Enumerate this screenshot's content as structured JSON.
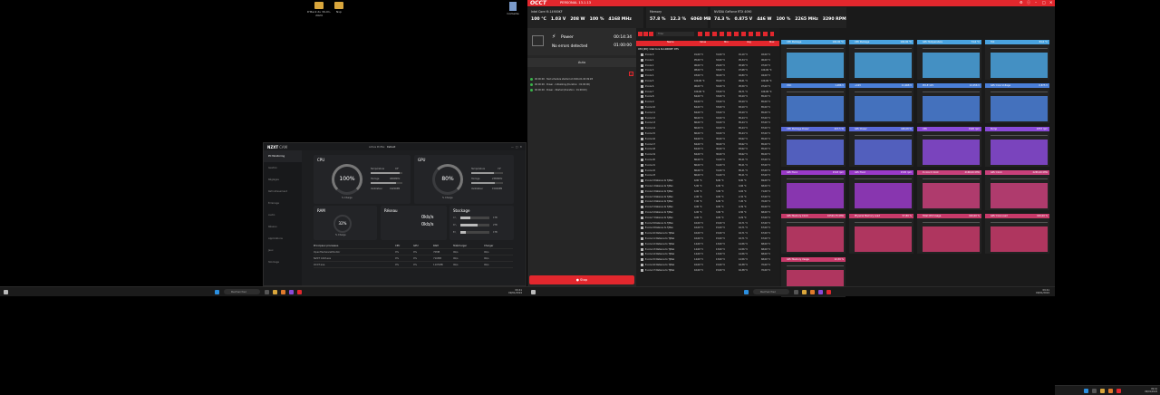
{
  "desktop": {
    "icons": [
      {
        "label": "D'Back du 30-01-2024",
        "kind": "folder"
      },
      {
        "label": "Nvp",
        "kind": "folder"
      },
      {
        "label": "Corbeille",
        "kind": "bin"
      }
    ]
  },
  "taskbar_left": {
    "search": "Rechercher",
    "time": "09:41",
    "date": "09/01/2024"
  },
  "taskbar_right": {
    "search": "Rechercher",
    "time": "09:41",
    "date": "09/01/2024"
  },
  "taskbar_far": {
    "time": "09:41",
    "date": "09/01/2024"
  },
  "nzxt": {
    "brand": "NZXT",
    "app": "CAM",
    "profile_label": "Active Profile:",
    "profile_value": "Default",
    "sidebar": [
      "PC Monitoring",
      "Gestion",
      "Réglages",
      "Refroidissement",
      "Éclairage",
      "Audio",
      "Réseau",
      "Applications",
      "Jeux",
      "Stockage"
    ],
    "cpu": {
      "title": "CPU",
      "load": "100%",
      "temp_label": "Température",
      "temp": "93°",
      "clock_label": "Horloge",
      "clock": "4800MHz",
      "fan_label": "Ventilateur",
      "fan": "1920RPM",
      "sub": "% Charge"
    },
    "gpu": {
      "title": "GPU",
      "load": "80%",
      "temp_label": "Température",
      "temp": "74°",
      "clock_label": "Horloge",
      "clock": "2385MHz",
      "fan_label": "Ventilateur",
      "fan": "1500RPM",
      "sub": "% Charge"
    },
    "ram": {
      "title": "RAM",
      "load": "32%",
      "sub": "% Charge"
    },
    "network": {
      "title": "Réseau",
      "down": "0kb/s",
      "up": "0kb/s"
    },
    "storage": {
      "title": "Stockage",
      "drives": [
        {
          "letter": "C:\\",
          "size": "1TB",
          "fill": 0.35
        },
        {
          "letter": "D:\\",
          "size": "2TB",
          "fill": 0.6
        },
        {
          "letter": "E:\\",
          "size": "1TB",
          "fill": 0.2
        }
      ]
    },
    "processes": {
      "headers": [
        "Principaux processus",
        "CPU",
        "GPU",
        "RAM",
        "Télécharger",
        "Charger"
      ],
      "rows": [
        [
          "OpenHardwareMonitor",
          "0%",
          "0%",
          "70MB",
          "0b/s",
          "0b/s"
        ],
        [
          "NZXT CAM.exe",
          "0%",
          "0%",
          "716MB",
          "0b/s",
          "0b/s"
        ],
        [
          "OCCT.exe",
          "0%",
          "0%",
          "1105MB",
          "0b/s",
          "0b/s"
        ]
      ]
    }
  },
  "occt": {
    "logo": "OCCT",
    "edition": "PERSONAL 13.1.13",
    "cpu": {
      "name": "Intel Core i9-14900KF",
      "values": [
        "100 °C",
        "1.03 V",
        "208 W",
        "100 %",
        "4168 MHz"
      ]
    },
    "memory": {
      "name": "Memory",
      "values": [
        "57.8 %",
        "12.3 %",
        "6060 MB"
      ]
    },
    "gpu": {
      "name": "NVIDIA GeForce RTX 4090",
      "values": [
        "74.3 %",
        "0.875 V",
        "446 W",
        "100 %",
        "2265 MHz",
        "3290 RPM"
      ]
    },
    "power_title": "Power",
    "status": "No errors detected",
    "timer": "00:14:34",
    "duration": "01:00:00",
    "mode": "Auto",
    "logs": [
      "00:00:00 · Test schedule started at 2024-01-09 09:28",
      "00:00:00 · Power - Initializing (Duration : 01:00:00)",
      "00:00:00 · Power - Started (Duration : 01:00:00)"
    ],
    "stop": "Stop",
    "filter": "Filter",
    "table": {
      "headers": [
        "Name",
        "Value",
        "Min",
        "Avg",
        "Max"
      ],
      "group": "CPU [#0]: Intel Core i9-14900KF: DTS",
      "rows": [
        [
          "P-core 0",
          "91,00 °C",
          "31,00 °C",
          "91,10 °C",
          "92,00 °C"
        ],
        [
          "P-core 1",
          "95,00 °C",
          "32,00 °C",
          "95,34 °C",
          "96,00 °C"
        ],
        [
          "P-core 2",
          "96,00 °C",
          "29,00 °C",
          "95,98 °C",
          "97,00 °C"
        ],
        [
          "P-core 3",
          "98,00 °C",
          "33,00 °C",
          "97,68 °C",
          "100,00 °C"
        ],
        [
          "P-core 4",
          "93,00 °C",
          "30,00 °C",
          "92,80 °C",
          "94,00 °C"
        ],
        [
          "P-core 5",
          "100,00 °C",
          "35,00 °C",
          "99,61 °C",
          "100,00 °C"
        ],
        [
          "P-core 6",
          "96,00 °C",
          "32,00 °C",
          "95,50 °C",
          "97,00 °C"
        ],
        [
          "P-core 7",
          "100,00 °C",
          "33,00 °C",
          "99,71 °C",
          "100,00 °C"
        ],
        [
          "E-core 8",
          "84,00 °C",
          "33,00 °C",
          "83,29 °C",
          "85,00 °C"
        ],
        [
          "E-core 9",
          "84,00 °C",
          "33,00 °C",
          "83,29 °C",
          "85,00 °C"
        ],
        [
          "E-core 10",
          "84,00 °C",
          "33,00 °C",
          "83,29 °C",
          "85,00 °C"
        ],
        [
          "E-core 11",
          "84,00 °C",
          "33,00 °C",
          "83,29 °C",
          "85,00 °C"
        ],
        [
          "E-core 12",
          "86,00 °C",
          "32,00 °C",
          "85,44 °C",
          "87,00 °C"
        ],
        [
          "E-core 13",
          "86,00 °C",
          "32,00 °C",
          "85,44 °C",
          "87,00 °C"
        ],
        [
          "E-core 14",
          "86,00 °C",
          "32,00 °C",
          "85,44 °C",
          "87,00 °C"
        ],
        [
          "E-core 15",
          "86,00 °C",
          "32,00 °C",
          "85,44 °C",
          "87,00 °C"
        ],
        [
          "E-core 16",
          "84,00 °C",
          "30,00 °C",
          "83,62 °C",
          "85,00 °C"
        ],
        [
          "E-core 17",
          "84,00 °C",
          "30,00 °C",
          "83,62 °C",
          "85,00 °C"
        ],
        [
          "E-core 18",
          "84,00 °C",
          "30,00 °C",
          "83,62 °C",
          "85,00 °C"
        ],
        [
          "E-core 19",
          "84,00 °C",
          "30,00 °C",
          "83,62 °C",
          "85,00 °C"
        ],
        [
          "E-core 20",
          "86,00 °C",
          "31,00 °C",
          "85,21 °C",
          "87,00 °C"
        ],
        [
          "E-core 21",
          "86,00 °C",
          "31,00 °C",
          "85,21 °C",
          "87,00 °C"
        ],
        [
          "E-core 22",
          "86,00 °C",
          "31,00 °C",
          "85,21 °C",
          "87,00 °C"
        ],
        [
          "E-core 23",
          "86,00 °C",
          "31,00 °C",
          "85,21 °C",
          "87,00 °C"
        ],
        [
          "P-core 0 Distance to TjMax",
          "9,00 °C",
          "8,00 °C",
          "8,90 °C",
          "69,00 °C"
        ],
        [
          "P-core 1 Distance to TjMax",
          "5,00 °C",
          "4,00 °C",
          "4,66 °C",
          "68,00 °C"
        ],
        [
          "P-core 2 Distance to TjMax",
          "4,00 °C",
          "3,00 °C",
          "4,02 °C",
          "71,00 °C"
        ],
        [
          "P-core 3 Distance to TjMax",
          "2,00 °C",
          "0,00 °C",
          "2,32 °C",
          "67,00 °C"
        ],
        [
          "P-core 4 Distance to TjMax",
          "7,00 °C",
          "6,00 °C",
          "7,20 °C",
          "70,00 °C"
        ],
        [
          "P-core 5 Distance to TjMax",
          "0,00 °C",
          "0,00 °C",
          "0,39 °C",
          "65,00 °C"
        ],
        [
          "P-core 6 Distance to TjMax",
          "4,00 °C",
          "3,00 °C",
          "4,50 °C",
          "68,00 °C"
        ],
        [
          "P-core 7 Distance to TjMax",
          "0,00 °C",
          "0,00 °C",
          "0,29 °C",
          "67,00 °C"
        ],
        [
          "E-core 8 Distance to TjMax",
          "16,00 °C",
          "15,00 °C",
          "16,71 °C",
          "67,00 °C"
        ],
        [
          "E-core 9 Distance to TjMax",
          "16,00 °C",
          "15,00 °C",
          "16,71 °C",
          "67,00 °C"
        ],
        [
          "E-core 10 Distance to TjMax",
          "16,00 °C",
          "15,00 °C",
          "16,71 °C",
          "67,00 °C"
        ],
        [
          "E-core 11 Distance to TjMax",
          "16,00 °C",
          "15,00 °C",
          "16,71 °C",
          "67,00 °C"
        ],
        [
          "E-core 12 Distance to TjMax",
          "14,00 °C",
          "13,00 °C",
          "14,56 °C",
          "68,00 °C"
        ],
        [
          "E-core 13 Distance to TjMax",
          "14,00 °C",
          "13,00 °C",
          "14,56 °C",
          "68,00 °C"
        ],
        [
          "E-core 14 Distance to TjMax",
          "14,00 °C",
          "13,00 °C",
          "14,56 °C",
          "68,00 °C"
        ],
        [
          "E-core 15 Distance to TjMax",
          "14,00 °C",
          "13,00 °C",
          "14,56 °C",
          "68,00 °C"
        ],
        [
          "E-core 16 Distance to TjMax",
          "16,00 °C",
          "15,00 °C",
          "16,38 °C",
          "70,00 °C"
        ],
        [
          "E-core 17 Distance to TjMax",
          "16,00 °C",
          "15,00 °C",
          "16,38 °C",
          "70,00 °C"
        ]
      ]
    },
    "charts": [
      {
        "title": "CPU Package",
        "value": "100,00 °C",
        "color": "#4aa3df"
      },
      {
        "title": "CPU Package",
        "value": "100,00 °C",
        "color": "#4aa3df"
      },
      {
        "title": "GPU Temperature",
        "value": "74,0 °C",
        "color": "#4aa3df"
      },
      {
        "title": "Hot",
        "value": "84,0 °C",
        "color": "#4aa3df"
      },
      {
        "title": "VCC",
        "value": "1,286 V",
        "color": "#4a7fd8"
      },
      {
        "title": "+12V",
        "value": "11,968 V",
        "color": "#4a7fd8"
      },
      {
        "title": "PCI-E 12V",
        "value": "12,056 V",
        "color": "#4a7fd8"
      },
      {
        "title": "GPU Core Voltage",
        "value": "0,875 V",
        "color": "#4a7fd8"
      },
      {
        "title": "CPU Package Power",
        "value": "207,5 W",
        "color": "#5a6ad8"
      },
      {
        "title": "GPU Power",
        "value": "446,08 W",
        "color": "#5a6ad8"
      },
      {
        "title": "CPU",
        "value": "1920 rpm",
        "color": "#8a4ad8"
      },
      {
        "title": "Pump",
        "value": "2857 rpm",
        "color": "#8a4ad8"
      },
      {
        "title": "GPU Fan1",
        "value": "1543 rpm",
        "color": "#9a3ac8"
      },
      {
        "title": "GPU Fan2",
        "value": "1545 rpm",
        "color": "#9a3ac8"
      },
      {
        "title": "P-core 0 Clock",
        "value": "4168,00 MHz",
        "color": "#c8407a"
      },
      {
        "title": "GPU Clock",
        "value": "2265,00 MHz",
        "color": "#c8407a"
      },
      {
        "title": "GPU Memory Clock",
        "value": "10501,75 MHz",
        "color": "#c83a6a"
      },
      {
        "title": "Physical Memory Load",
        "value": "57,80 %",
        "color": "#c83a6a"
      },
      {
        "title": "Total CPU Usage",
        "value": "100,00 %",
        "color": "#c83a6a"
      },
      {
        "title": "GPU Core Load",
        "value": "100,00 %",
        "color": "#c83a6a"
      },
      {
        "title": "GPU Memory Usage",
        "value": "12,30 %",
        "color": "#c83a6a"
      }
    ]
  }
}
